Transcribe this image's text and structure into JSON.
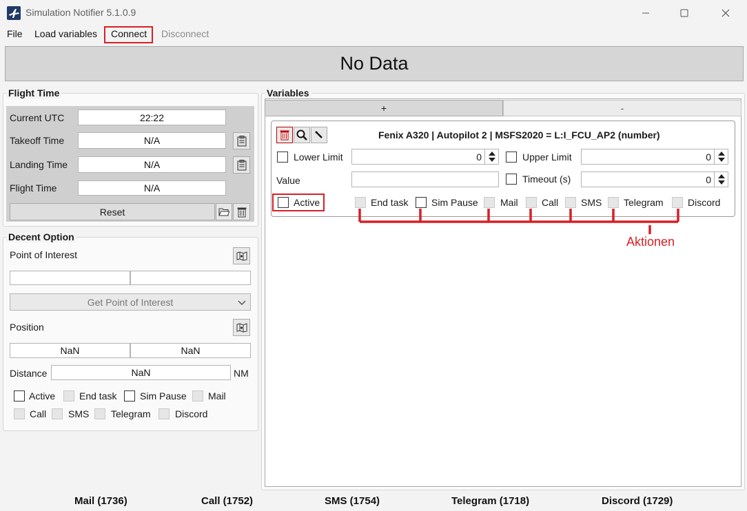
{
  "window": {
    "title": "Simulation Notifier 5.1.0.9"
  },
  "menu": {
    "file": "File",
    "load_variables": "Load variables",
    "connect": "Connect",
    "disconnect": "Disconnect"
  },
  "banner": "No Data",
  "flight_time": {
    "title": "Flight Time",
    "current_utc_label": "Current UTC",
    "current_utc_value": "22:22",
    "takeoff_label": "Takeoff Time",
    "takeoff_value": "N/A",
    "landing_label": "Landing Time",
    "landing_value": "N/A",
    "flight_label": "Flight Time",
    "flight_value": "N/A",
    "reset_label": "Reset"
  },
  "descent": {
    "title": "Decent Option",
    "poi_label": "Point of Interest",
    "poi_field_1": "",
    "poi_field_2": "",
    "get_poi_label": "Get Point of Interest",
    "position_label": "Position",
    "position_lat": "NaN",
    "position_lon": "NaN",
    "distance_label": "Distance",
    "distance_value": "NaN",
    "distance_unit": "NM",
    "checks": {
      "active": "Active",
      "end_task": "End task",
      "sim_pause": "Sim Pause",
      "mail": "Mail",
      "call": "Call",
      "sms": "SMS",
      "telegram": "Telegram",
      "discord": "Discord"
    }
  },
  "variables": {
    "title": "Variables",
    "tab_add": "+",
    "tab_remove": "-",
    "card": {
      "heading": "Fenix A320 | Autopilot 2 | MSFS2020 = L:I_FCU_AP2 (number)",
      "lower_limit_label": "Lower Limit",
      "lower_limit_value": "0",
      "upper_limit_label": "Upper Limit",
      "upper_limit_value": "0",
      "value_label": "Value",
      "value_value": "",
      "timeout_label": "Timeout (s)",
      "timeout_value": "0",
      "active_label": "Active",
      "actions": {
        "end_task": "End task",
        "sim_pause": "Sim Pause",
        "mail": "Mail",
        "call": "Call",
        "sms": "SMS",
        "telegram": "Telegram",
        "discord": "Discord"
      }
    },
    "annotation": "Aktionen"
  },
  "footer": {
    "mail": "Mail (1736)",
    "call": "Call (1752)",
    "sms": "SMS (1754)",
    "telegram": "Telegram (1718)",
    "discord": "Discord (1729)"
  },
  "colors": {
    "highlight": "#d61f26",
    "app_icon": "#1f3a68"
  }
}
